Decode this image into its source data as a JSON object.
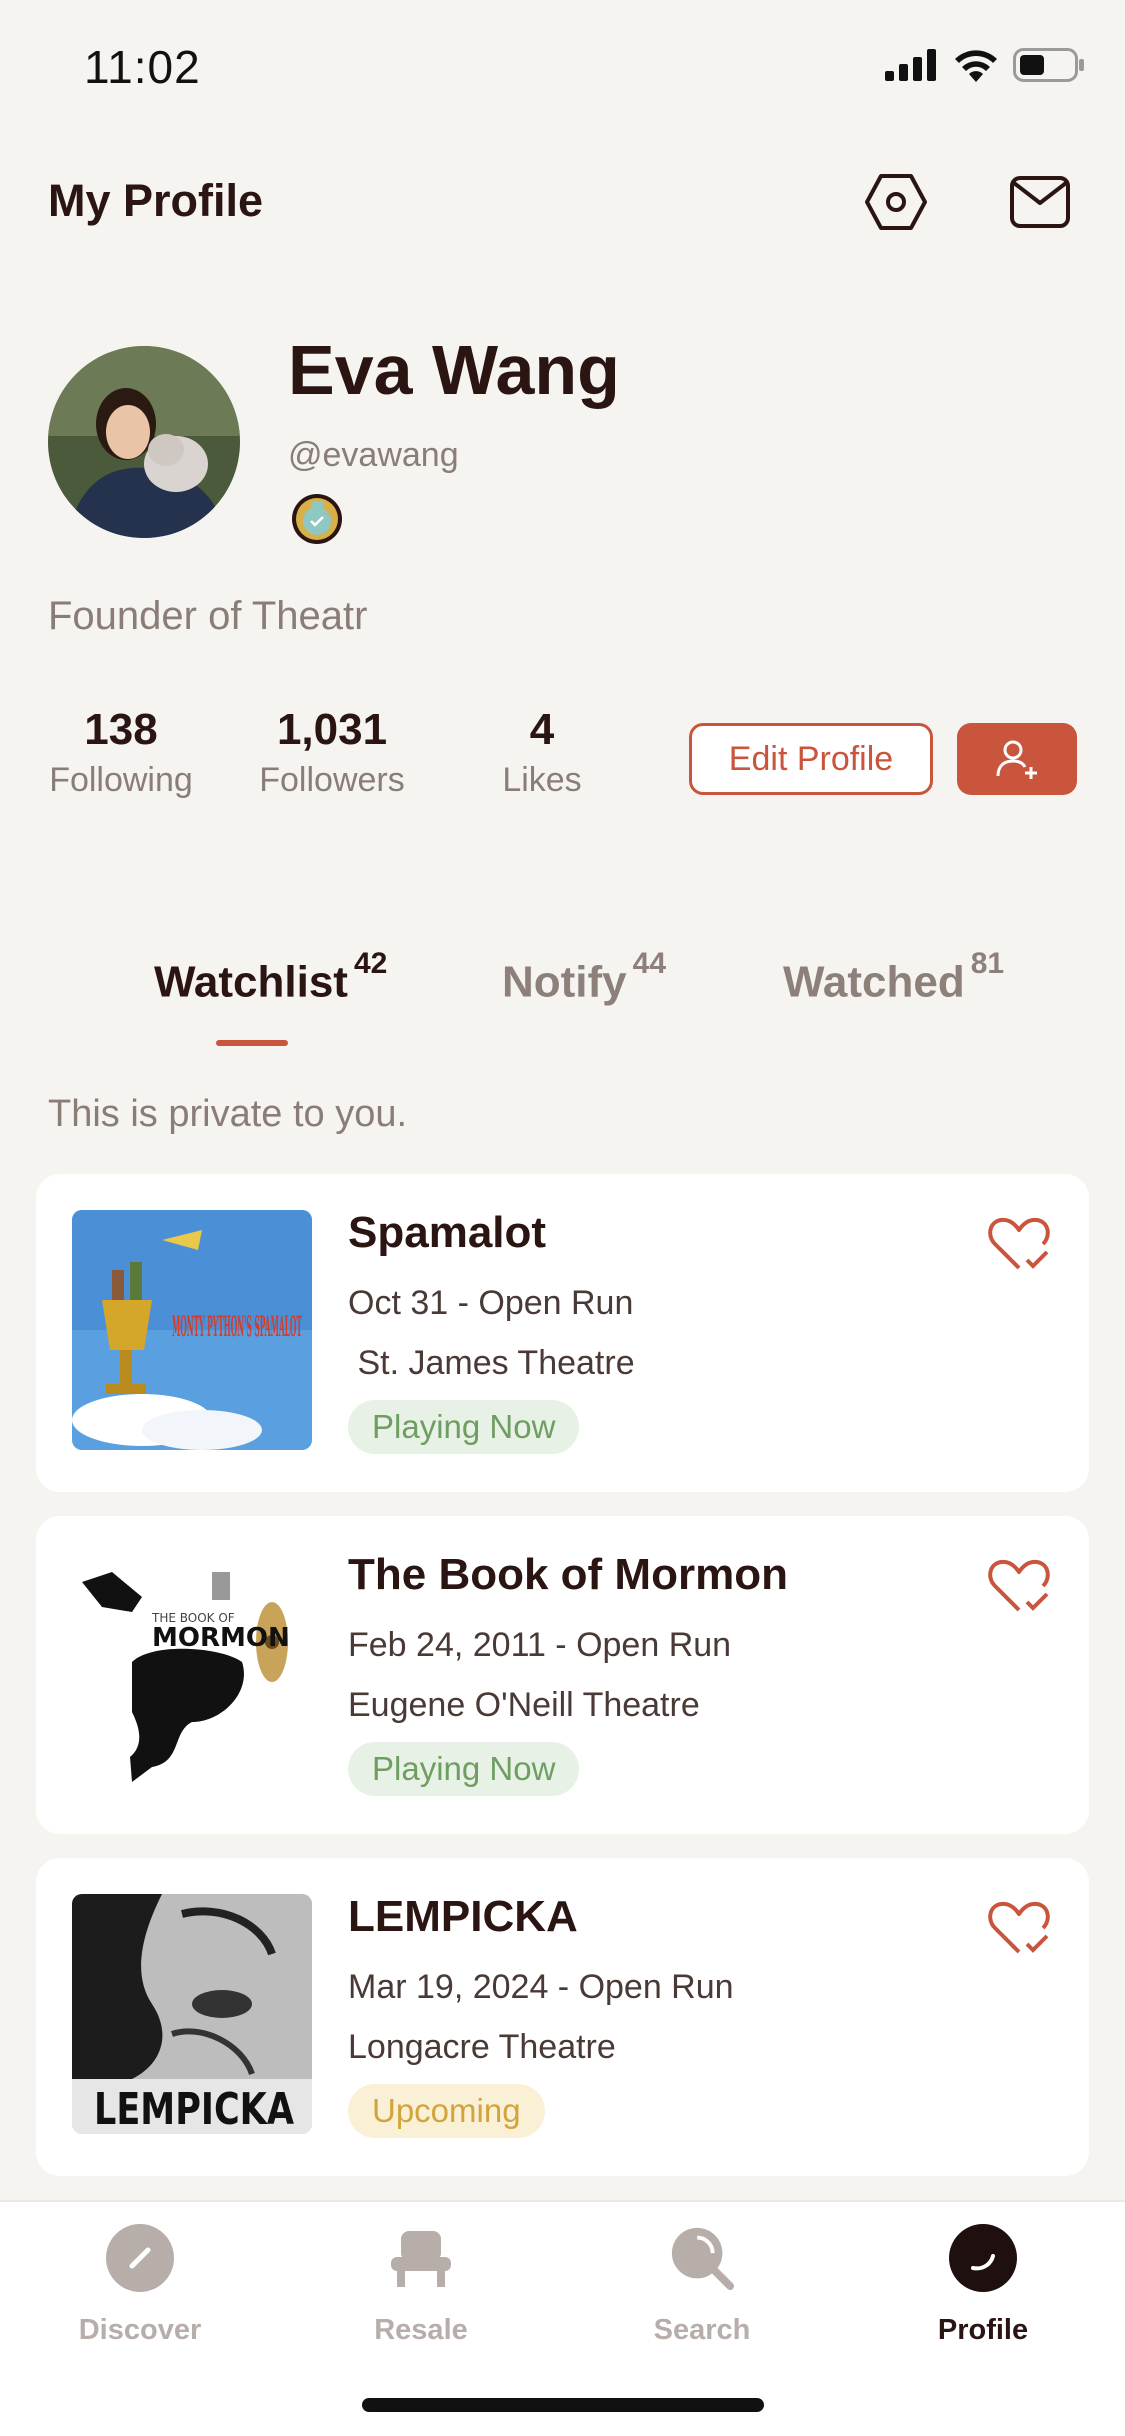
{
  "status_bar": {
    "time": "11:02"
  },
  "header": {
    "title": "My Profile",
    "settings_icon": "settings-hexagon-icon",
    "inbox_icon": "mail-icon"
  },
  "profile": {
    "name": "Eva Wang",
    "handle": "@evawang",
    "bio": "Founder of Theatr",
    "stats": [
      {
        "value": "138",
        "label": "Following"
      },
      {
        "value": "1,031",
        "label": "Followers"
      },
      {
        "value": "4",
        "label": "Likes"
      }
    ],
    "edit_label": "Edit Profile"
  },
  "tabs": [
    {
      "label": "Watchlist",
      "count": "42",
      "active": true
    },
    {
      "label": "Notify",
      "count": "44",
      "active": false
    },
    {
      "label": "Watched",
      "count": "81",
      "active": false
    }
  ],
  "private_note": "This is private to you.",
  "watchlist": [
    {
      "title": "Spamalot",
      "dates": "Oct 31 - Open Run",
      "venue": " St. James Theatre",
      "status": "Playing Now",
      "status_type": "playing"
    },
    {
      "title": "The Book of Mormon",
      "dates": "Feb 24, 2011 - Open Run",
      "venue": "Eugene O'Neill Theatre",
      "status": "Playing Now",
      "status_type": "playing"
    },
    {
      "title": "LEMPICKA",
      "dates": "Mar 19, 2024 - Open Run",
      "venue": "Longacre Theatre",
      "status": "Upcoming",
      "status_type": "upcoming"
    }
  ],
  "posters": {
    "spamalot": "MONTY PYTHON'S SPAMALOT",
    "mormon_small": "THE BOOK OF",
    "mormon": "MORMON",
    "lempicka": "LEMPICKA"
  },
  "nav": [
    {
      "label": "Discover",
      "icon": "compass-icon",
      "active": false
    },
    {
      "label": "Resale",
      "icon": "seat-icon",
      "active": false
    },
    {
      "label": "Search",
      "icon": "search-icon",
      "active": false
    },
    {
      "label": "Profile",
      "icon": "profile-icon",
      "active": true
    }
  ],
  "colors": {
    "accent": "#c9553d",
    "background": "#f6f4f1",
    "text": "#2a1513",
    "muted": "#8a7d78"
  }
}
